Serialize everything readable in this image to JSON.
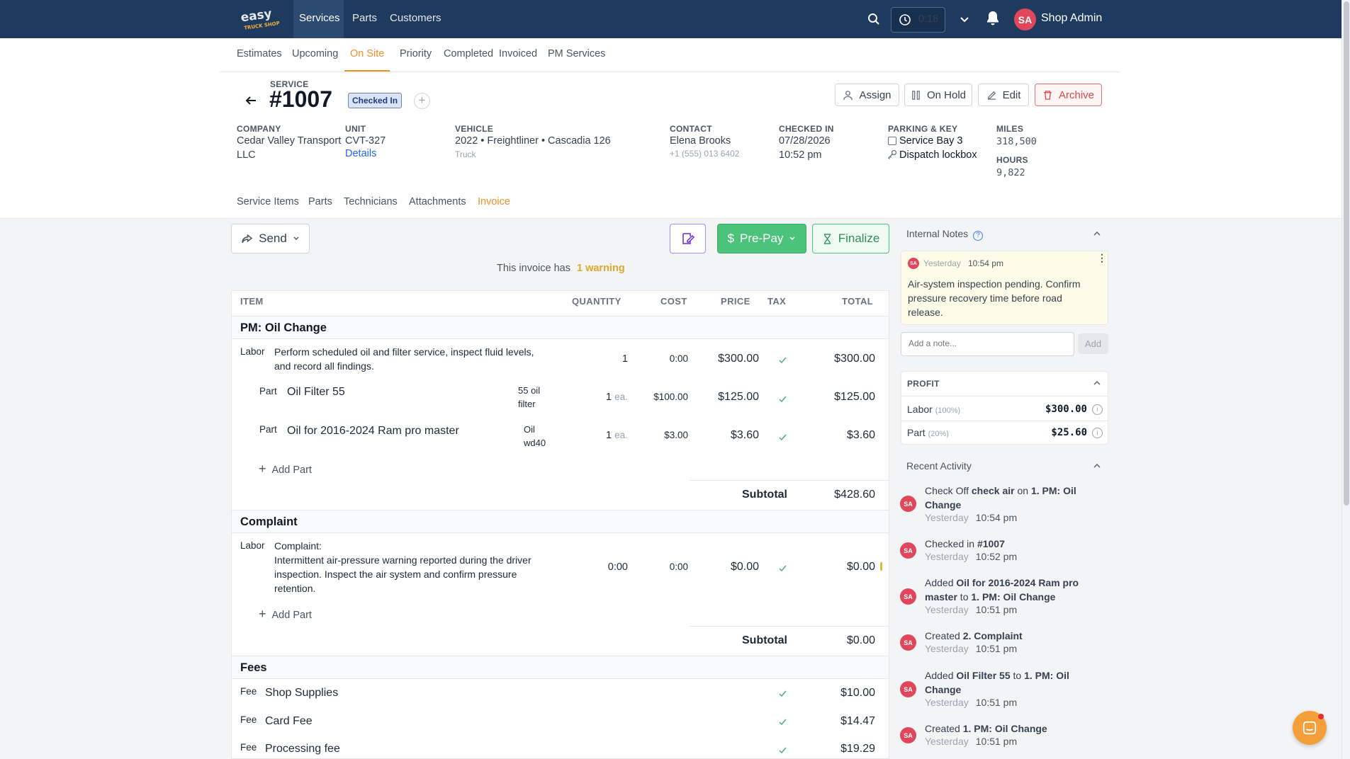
{
  "nav": {
    "services": "Services",
    "parts": "Parts",
    "customers": "Customers",
    "timer": "0:18",
    "user_initials": "SA",
    "user_name": "Shop Admin",
    "logo_text": "easy TRUCK SHOP"
  },
  "subnav": [
    "Estimates",
    "Upcoming",
    "On Site",
    "Priority",
    "Completed",
    "Invoiced",
    "PM Services"
  ],
  "service": {
    "label": "SERVICE",
    "number": "#1007",
    "status": "Checked In",
    "company_label": "COMPANY",
    "company": "Cedar Valley Transport",
    "company2": "LLC",
    "unit_label": "UNIT",
    "unit": "CVT-327",
    "details": "Details",
    "vehicle_label": "VEHICLE",
    "vehicle": "2022 • Freightliner • Cascadia 126",
    "vehicle_type": "Truck",
    "contact_label": "CONTACT",
    "contact": "Elena Brooks",
    "phone": "+1 (555) 013 6402",
    "checked_in_label": "CHECKED IN",
    "checked_in_date": "07/28/2026",
    "checked_in_time": "10:52 pm",
    "parking_label": "PARKING & KEY",
    "parking": "Service Bay 3",
    "key": "Dispatch lockbox",
    "miles_label": "MILES",
    "miles": "318,500",
    "hours_label": "HOURS",
    "hours": "9,822"
  },
  "actions": {
    "assign": "Assign",
    "on_hold": "On Hold",
    "edit": "Edit",
    "archive": "Archive"
  },
  "section_tabs": [
    "Service Items",
    "Parts",
    "Technicians",
    "Attachments",
    "Invoice"
  ],
  "invoice": {
    "send": "Send",
    "prepay": "Pre-Pay",
    "finalize": "Finalize",
    "warning_prefix": "This invoice has",
    "warning_link": "1 warning",
    "headers": {
      "item": "ITEM",
      "quantity": "QUANTITY",
      "cost": "COST",
      "price": "PRICE",
      "tax": "TAX",
      "total": "TOTAL"
    },
    "pm": {
      "title": "PM: Oil Change",
      "labor_tag": "Labor",
      "labor_desc1": "Perform scheduled oil and filter service, inspect fluid levels,",
      "labor_desc2": "and record all findings.",
      "labor_qty": "1",
      "labor_cost": "0:00",
      "labor_price": "$300.00",
      "labor_total": "$300.00",
      "part_tag": "Part",
      "p1_name": "Oil Filter 55",
      "p1_note1": "55 oil",
      "p1_note2": "filter",
      "p1_qty": "1",
      "p1_unit": "ea.",
      "p1_cost": "$100.00",
      "p1_price": "$125.00",
      "p1_total": "$125.00",
      "p2_name": "Oil for 2016-2024 Ram pro master",
      "p2_note1": "Oil",
      "p2_note2": "wd40",
      "p2_qty": "1",
      "p2_unit": "ea.",
      "p2_cost": "$3.00",
      "p2_price": "$3.60",
      "p2_total": "$3.60",
      "add_part": "Add Part",
      "subtotal_label": "Subtotal",
      "subtotal": "$428.60"
    },
    "complaint": {
      "title": "Complaint",
      "labor_tag": "Labor",
      "d1": "Complaint:",
      "d2": "Intermittent air-pressure warning reported during the driver",
      "d3": "inspection. Inspect the air system and confirm pressure",
      "d4": "retention.",
      "qty": "0:00",
      "cost": "0:00",
      "price": "$0.00",
      "total": "$0.00",
      "add_part": "Add Part",
      "subtotal_label": "Subtotal",
      "subtotal": "$0.00"
    },
    "fees": {
      "title": "Fees",
      "tag": "Fee",
      "items": [
        {
          "name": "Shop Supplies",
          "total": "$10.00"
        },
        {
          "name": "Card Fee",
          "total": "$14.47"
        },
        {
          "name": "Processing fee",
          "total": "$19.29"
        }
      ]
    }
  },
  "notes": {
    "title": "Internal Notes",
    "when": "Yesterday",
    "time": "10:54 pm",
    "text1": "Air-system inspection pending. Confirm",
    "text2": "pressure recovery time before road",
    "text3": "release.",
    "placeholder": "Add a note...",
    "add": "Add"
  },
  "profit": {
    "title": "PROFIT",
    "labor": "Labor",
    "labor_pct": "(100%)",
    "labor_val": "$300.00",
    "part": "Part",
    "part_pct": "(20%)",
    "part_val": "$25.60"
  },
  "activity": {
    "title": "Recent Activity",
    "a1": {
      "pre": "Check Off ",
      "b1": "check air",
      "mid": " on ",
      "b2": "1. PM: Oil",
      "b3": "Change",
      "when": "Yesterday",
      "time": "10:54 pm"
    },
    "a2": {
      "pre": "Checked in ",
      "b1": "#1007",
      "when": "Yesterday",
      "time": "10:52 pm"
    },
    "a3": {
      "pre": "Added ",
      "b1": "Oil for 2016-2024 Ram pro",
      "b2": "master",
      "mid": " to ",
      "b3": "1. PM: Oil Change",
      "when": "Yesterday",
      "time": "10:51 pm"
    },
    "a4": {
      "pre": "Created ",
      "b1": "2. Complaint",
      "when": "Yesterday",
      "time": "10:51 pm"
    },
    "a5": {
      "pre": "Added ",
      "b1": "Oil Filter 55",
      "mid": " to ",
      "b2": "1. PM: Oil",
      "b3": "Change",
      "when": "Yesterday",
      "time": "10:51 pm"
    },
    "a6": {
      "pre": "Created ",
      "b1": "1. PM: Oil Change",
      "when": "Yesterday",
      "time": "10:51 pm"
    }
  },
  "colors": {
    "nav_bg": "#1f3a5f",
    "accent": "#f0902c",
    "success": "#4caf7a",
    "danger": "#d84a4a",
    "avatar": "#e0475a"
  }
}
